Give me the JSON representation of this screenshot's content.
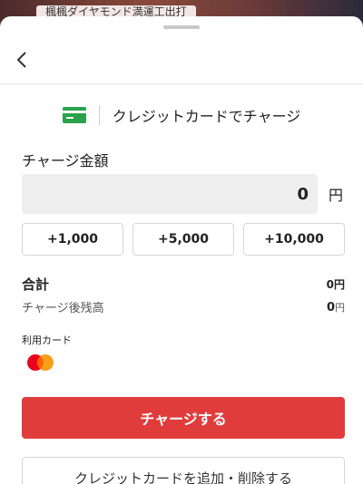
{
  "background": {
    "tag_text": "楓楓ダイヤモンド満運工出打"
  },
  "header": {
    "back_icon": "chevron-left-icon"
  },
  "method": {
    "icon": "credit-card-icon",
    "title": "クレジットカードでチャージ",
    "icon_color": "#2ba14b"
  },
  "amount": {
    "label": "チャージ金額",
    "value": "0",
    "unit": "円"
  },
  "quick_amounts": [
    "+1,000",
    "+5,000",
    "+10,000"
  ],
  "summary": {
    "total_label": "合計",
    "total_value": "0円",
    "balance_label": "チャージ後残高",
    "balance_value": "0",
    "balance_unit": "円"
  },
  "card": {
    "label": "利用カード",
    "brand_icon": "mastercard-icon"
  },
  "actions": {
    "charge_label": "チャージする",
    "charge_color": "#e03c3c",
    "manage_label": "クレジットカードを追加・削除する"
  }
}
